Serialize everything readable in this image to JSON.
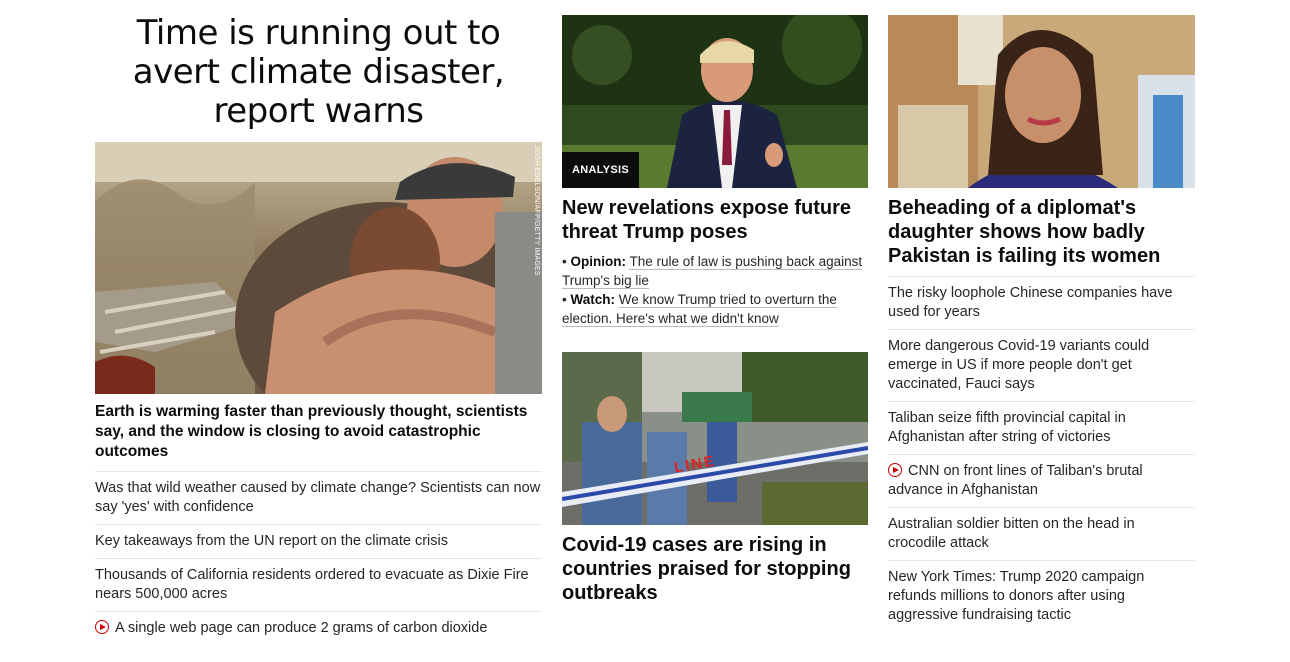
{
  "col1": {
    "hero_title": "Time is running out to avert climate disaster, report warns",
    "image_credit": "JOSH EDELSON/AFP/GETTY IMAGES",
    "lead": "Earth is warming faster than previously thought, scientists say, and the window is closing to avoid catastrophic outcomes",
    "items": [
      {
        "text": "Was that wild weather caused by climate change? Scientists can now say 'yes' with confidence",
        "video": false
      },
      {
        "text": "Key takeaways from the UN report on the climate crisis",
        "video": false
      },
      {
        "text": "Thousands of California residents ordered to evacuate as Dixie Fire nears 500,000 acres",
        "video": false
      },
      {
        "text": "A single web page can produce 2 grams of carbon dioxide",
        "video": true
      }
    ]
  },
  "col2": {
    "badge": "ANALYSIS",
    "headline": "New revelations expose future threat Trump poses",
    "subs": [
      {
        "label": "Opinion:",
        "text": "The rule of law is pushing back against Trump's big lie"
      },
      {
        "label": "Watch:",
        "text": "We know Trump tried to overturn the election. Here's what we didn't know"
      }
    ],
    "covid_tape": "LINE",
    "covid_headline": "Covid-19 cases are rising in countries praised for stopping outbreaks"
  },
  "col3": {
    "headline": "Beheading of a diplomat's daughter shows how badly Pakistan is failing its women",
    "items": [
      {
        "text": "The risky loophole Chinese companies have used for years",
        "video": false
      },
      {
        "text": "More dangerous Covid-19 variants could emerge in US if more people don't get vaccinated, Fauci says",
        "video": false
      },
      {
        "text": "Taliban seize fifth provincial capital in Afghanistan after string of victories",
        "video": false
      },
      {
        "text": "CNN on front lines of Taliban's brutal advance in Afghanistan",
        "video": true
      },
      {
        "text": "Australian soldier bitten on the head in crocodile attack",
        "video": false
      },
      {
        "text": "New York Times: Trump 2020 campaign refunds millions to donors after using aggressive fundraising tactic",
        "video": false
      }
    ]
  },
  "colors": {
    "video_icon": "#cc0000",
    "badge_bg": "#0c0c0c",
    "divider": "#e6e6e6"
  }
}
